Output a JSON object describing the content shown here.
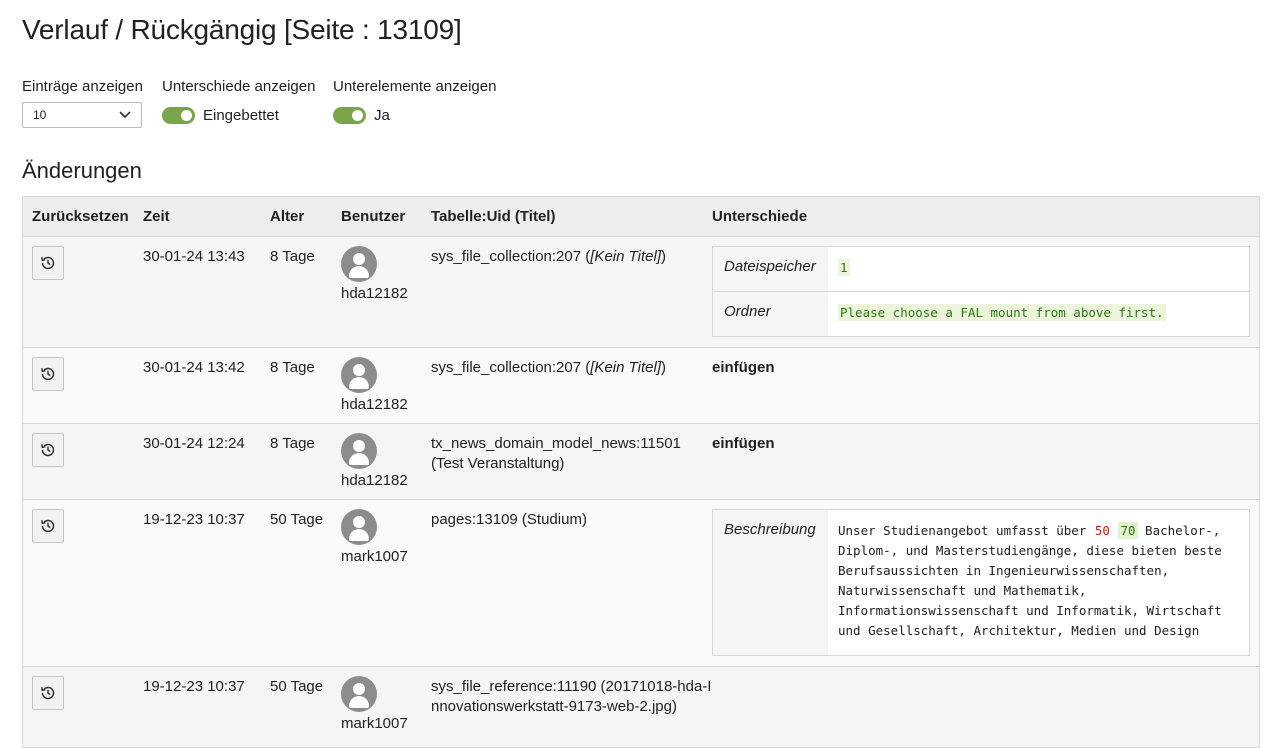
{
  "page": {
    "title": "Verlauf / Rückgängig [Seite : 13109]",
    "section_title": "Änderungen"
  },
  "filters": {
    "entries": {
      "label": "Einträge anzeigen",
      "value": "10"
    },
    "differences": {
      "label": "Unterschiede anzeigen",
      "toggle_label": "Eingebettet",
      "enabled": true
    },
    "subelements": {
      "label": "Unterelemente anzeigen",
      "toggle_label": "Ja",
      "enabled": true
    }
  },
  "colors": {
    "toggle_on": "#79a548",
    "diff_added": "#2c7a12",
    "diff_removed": "#c0211c"
  },
  "table": {
    "headers": {
      "revert": "Zurücksetzen",
      "time": "Zeit",
      "age": "Alter",
      "user": "Benutzer",
      "record": "Tabelle:Uid (Titel)",
      "diff": "Unterschiede"
    },
    "rows": [
      {
        "time": "30-01-24 13:43",
        "age": "8 Tage",
        "user": "hda12182",
        "record_prefix": "sys_file_collection:207 (",
        "record_title": "[Kein Titel]",
        "record_suffix": ")",
        "diff": [
          {
            "field": "Dateispeicher",
            "value": "1"
          },
          {
            "field": "Ordner",
            "value": "Please choose a FAL mount from above first."
          }
        ]
      },
      {
        "time": "30-01-24 13:42",
        "age": "8 Tage",
        "user": "hda12182",
        "record_prefix": "sys_file_collection:207 (",
        "record_title": "[Kein Titel]",
        "record_suffix": ")",
        "insert": "einfügen"
      },
      {
        "time": "30-01-24 12:24",
        "age": "8 Tage",
        "user": "hda12182",
        "record_line1": "tx_news_domain_model_news:11501",
        "record_line2": "(Test Veranstaltung)",
        "insert": "einfügen"
      },
      {
        "time": "19-12-23 10:37",
        "age": "50 Tage",
        "user": "mark1007",
        "record": "pages:13109 (Studium)",
        "diff": {
          "field": "Beschreibung",
          "before": "Unser Studienangebot umfasst über ",
          "removed": "50",
          "added": "70",
          "after": " Bachelor-, Diplom-, und Masterstudiengänge, diese bieten beste Berufsaussichten in Ingenieurwissenschaften, Naturwissenschaft und Mathematik, Informationswissenschaft und Informatik, Wirtschaft und Gesellschaft, Architektur, Medien und Design"
        }
      },
      {
        "time": "19-12-23 10:37",
        "age": "50 Tage",
        "user": "mark1007",
        "record": "sys_file_reference:11190 (20171018-hda-Innovationswerkstatt-9173-web-2.jpg)"
      }
    ]
  }
}
